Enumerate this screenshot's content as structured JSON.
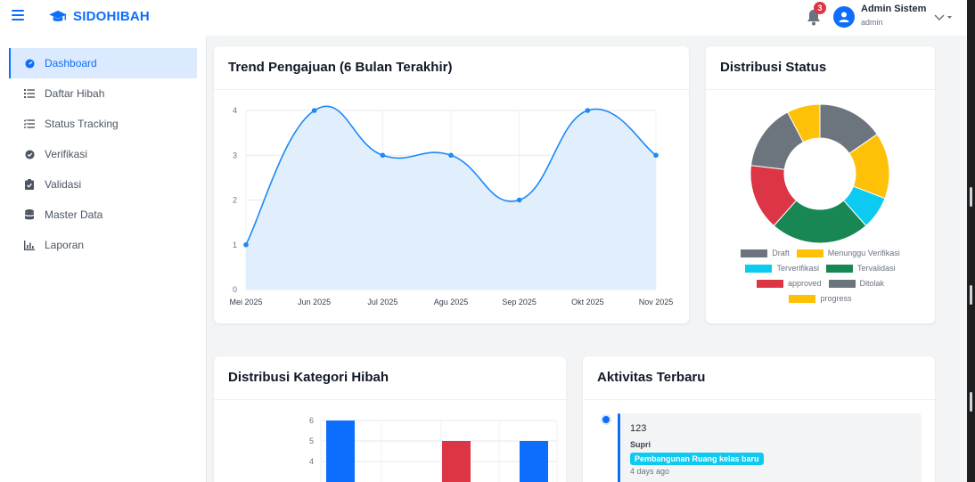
{
  "brand": {
    "name": "SIDOHIBAH"
  },
  "header": {
    "notification_count": "3",
    "user_name": "Admin Sistem",
    "user_role": "admin"
  },
  "sidebar": {
    "items": [
      {
        "label": "Dashboard",
        "icon": "dashboard-icon",
        "active": true
      },
      {
        "label": "Daftar Hibah",
        "icon": "list-icon",
        "active": false
      },
      {
        "label": "Status Tracking",
        "icon": "list-check-icon",
        "active": false
      },
      {
        "label": "Verifikasi",
        "icon": "check-circle-icon",
        "active": false
      },
      {
        "label": "Validasi",
        "icon": "clipboard-check-icon",
        "active": false
      },
      {
        "label": "Master Data",
        "icon": "database-icon",
        "active": false
      },
      {
        "label": "Laporan",
        "icon": "chart-icon",
        "active": false
      }
    ]
  },
  "cards": {
    "trend": {
      "title": "Trend Pengajuan (6 Bulan Terakhir)"
    },
    "status": {
      "title": "Distribusi Status"
    },
    "category": {
      "title": "Distribusi Kategori Hibah"
    },
    "activity": {
      "title": "Aktivitas Terbaru"
    }
  },
  "activity": {
    "items": [
      {
        "title": "123",
        "user": "Supri",
        "badge": "Pembangunan Ruang kelas baru",
        "time": "4 days ago"
      }
    ]
  },
  "chart_data": [
    {
      "type": "line",
      "title": "Trend Pengajuan (6 Bulan Terakhir)",
      "categories": [
        "Mei 2025",
        "Jun 2025",
        "Jul 2025",
        "Agu 2025",
        "Sep 2025",
        "Okt 2025",
        "Nov 2025"
      ],
      "series": [
        {
          "values": [
            1,
            4,
            3,
            3,
            2,
            4,
            3
          ]
        }
      ],
      "ylim": [
        0,
        4
      ],
      "yticks": [
        "0",
        "1",
        "2",
        "3",
        "4"
      ],
      "fill": true,
      "grid": true,
      "color": "#1e88f5",
      "fill_color": "#e1eefb"
    },
    {
      "type": "pie",
      "title": "Distribusi Status",
      "labels": [
        "Draft",
        "Menunggu Verifikasi",
        "Terverifikasi",
        "Tervalidasi",
        "approved",
        "Ditolak",
        "progress"
      ],
      "colors": [
        "#6c757d",
        "#ffc107",
        "#0dcaf0",
        "#198754",
        "#dc3545",
        "#6c757d",
        "#ffc107"
      ],
      "values": [
        2,
        2,
        1,
        3,
        2,
        2,
        1
      ],
      "legend_position": "bottom"
    },
    {
      "type": "bar",
      "title": "Distribusi Kategori Hibah",
      "values": [
        6,
        5,
        5
      ],
      "colors": [
        "#0d6efd",
        "#dc3545",
        "#0d6efd"
      ],
      "yticks": [
        "4",
        "5",
        "6"
      ],
      "grid": true
    }
  ]
}
